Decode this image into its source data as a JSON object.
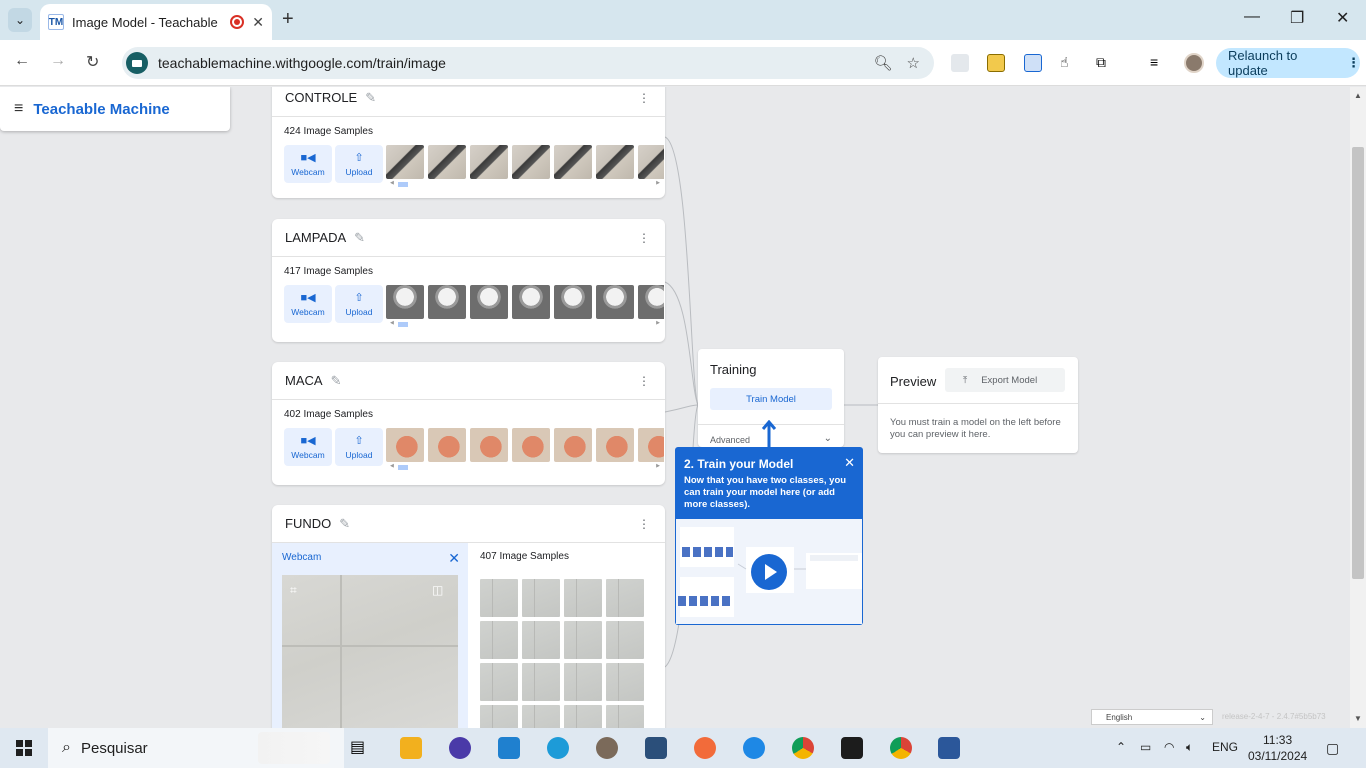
{
  "browser": {
    "tab_title": "Image Model - Teachable M",
    "tab_favicon": "TM",
    "new_tab": "+",
    "url": "teachablemachine.withgoogle.com/train/image",
    "relaunch_label": "Relaunch to update",
    "relaunch_dots": "⋮"
  },
  "app": {
    "menu_glyph": "≡",
    "name": "Teachable Machine"
  },
  "classes": [
    {
      "name": "CONTROLE",
      "count": "424 Image Samples",
      "thumb_kind": "remote"
    },
    {
      "name": "LAMPADA",
      "count": "417 Image Samples",
      "thumb_kind": "lamp"
    },
    {
      "name": "MACA",
      "count": "402 Image Samples",
      "thumb_kind": "apple"
    },
    {
      "name": "FUNDO",
      "count": "407 Image Samples"
    }
  ],
  "buttons": {
    "webcam": "Webcam",
    "upload": "Upload"
  },
  "webcam_panel": {
    "label": "Webcam"
  },
  "training": {
    "title": "Training",
    "train_button": "Train Model",
    "advanced": "Advanced"
  },
  "preview": {
    "title": "Preview",
    "export_button": "Export Model",
    "message": "You must train a model on the left before you can preview it here."
  },
  "tooltip": {
    "heading": "2. Train your Model",
    "body": "Now that you have two classes, you can train your model here (or add more classes)."
  },
  "footer": {
    "language": "English",
    "version": "release-2-4-7 - 2.4.7#5b5b73"
  },
  "taskbar": {
    "search_placeholder": "Pesquisar",
    "lang": "ENG",
    "time": "11:33",
    "date": "03/11/2024"
  },
  "colors": {
    "accent": "#1967d2",
    "chip_bg": "#e8f0fe",
    "relaunch_bg": "#c2e7ff"
  }
}
